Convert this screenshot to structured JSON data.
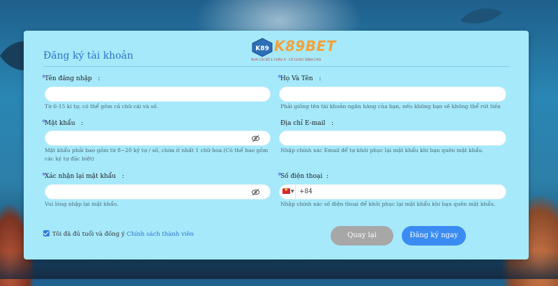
{
  "brand": {
    "logo_text": "K89BET",
    "tagline": "NHÀ CÁI SỐ 1 CHÂU Á · CÁ CƯỢC ĐỈNH CAO"
  },
  "form": {
    "title": "Đăng ký tài khoản",
    "fields": {
      "username": {
        "label": "Tên đăng nhập",
        "colon": ":",
        "value": "",
        "hint": "Từ 6-15 kí tự, có thể gồm cả chữ cái và số."
      },
      "fullname": {
        "label": "Họ Và Tên",
        "colon": ":",
        "value": "",
        "hint": "Phải giống tên tài khoản ngân hàng của bạn, nếu không bạn sẽ không thể rút tiền"
      },
      "password": {
        "label": "Mật khẩu",
        "colon": ":",
        "value": "",
        "hint": "Mật khẩu phải bao gồm từ 8~20 ký tự / số, chứa ít nhất 1 chữ hoa.(Có thể bao gồm các ký tự đặc biệt)"
      },
      "email": {
        "label": "Địa chỉ E-mail",
        "colon": ":",
        "value": "",
        "hint": "Nhập chính xác Email để tự khôi phục lại mật khẩu khi bạn quên mật khẩu."
      },
      "confirm_password": {
        "label": "Xác nhận lại mật khẩu",
        "colon": ":",
        "value": "",
        "hint": "Vui lòng nhập lại mật khẩu."
      },
      "phone": {
        "label": "Số điện thoại",
        "colon": ":",
        "dial_code": "+84",
        "value": "",
        "hint": "Nhập chính xác số điện thoại để khôi phục lại mật khẩu khi bạn quên mật khẩu."
      }
    },
    "agreement": {
      "text": "Tôi đã đủ tuổi và đồng ý",
      "link": "Chính sách thành viên",
      "checked": true
    },
    "buttons": {
      "back": "Quay lại",
      "submit": "Đăng ký ngay"
    }
  },
  "colors": {
    "panel_bg": "#a6e9fb",
    "title": "#2f72c9",
    "submit_button": "#3a8cf2",
    "back_button": "#a7a7a7",
    "logo_accent": "#f2a23a"
  },
  "icons": {
    "password_toggle": "eye-slash-icon",
    "confirm_toggle": "eye-slash-icon",
    "phone_flag": "vietnam-flag-icon",
    "agree_checkbox": "checkbox-checked-icon"
  }
}
